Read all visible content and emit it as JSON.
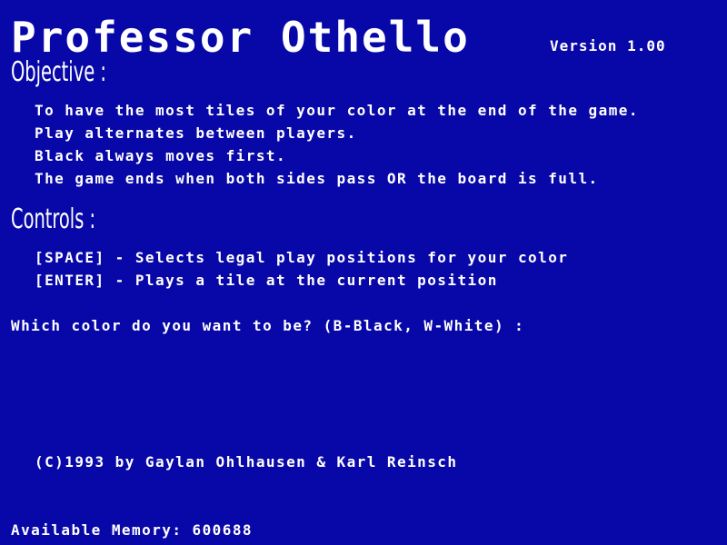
{
  "header": {
    "title": "Professor Othello",
    "version": "Version 1.00"
  },
  "objective": {
    "heading": "Objective :",
    "lines": [
      "To have the most tiles of your color at the end of the game.",
      "Play alternates between players.",
      "Black always moves first.",
      "The game ends when both sides pass OR the board is full."
    ]
  },
  "controls": {
    "heading": "Controls :",
    "lines": [
      "[SPACE] - Selects legal play positions for your color",
      "[ENTER] - Plays a tile at the current position"
    ]
  },
  "prompt": {
    "text": "Which color do you want to be? (B-Black, W-White) :"
  },
  "credits": {
    "text": "(C)1993 by Gaylan Ohlhausen & Karl Reinsch"
  },
  "status": {
    "memory": "Available Memory: 600688"
  },
  "colors": {
    "background": "#0808a8",
    "text": "#ffffff"
  }
}
